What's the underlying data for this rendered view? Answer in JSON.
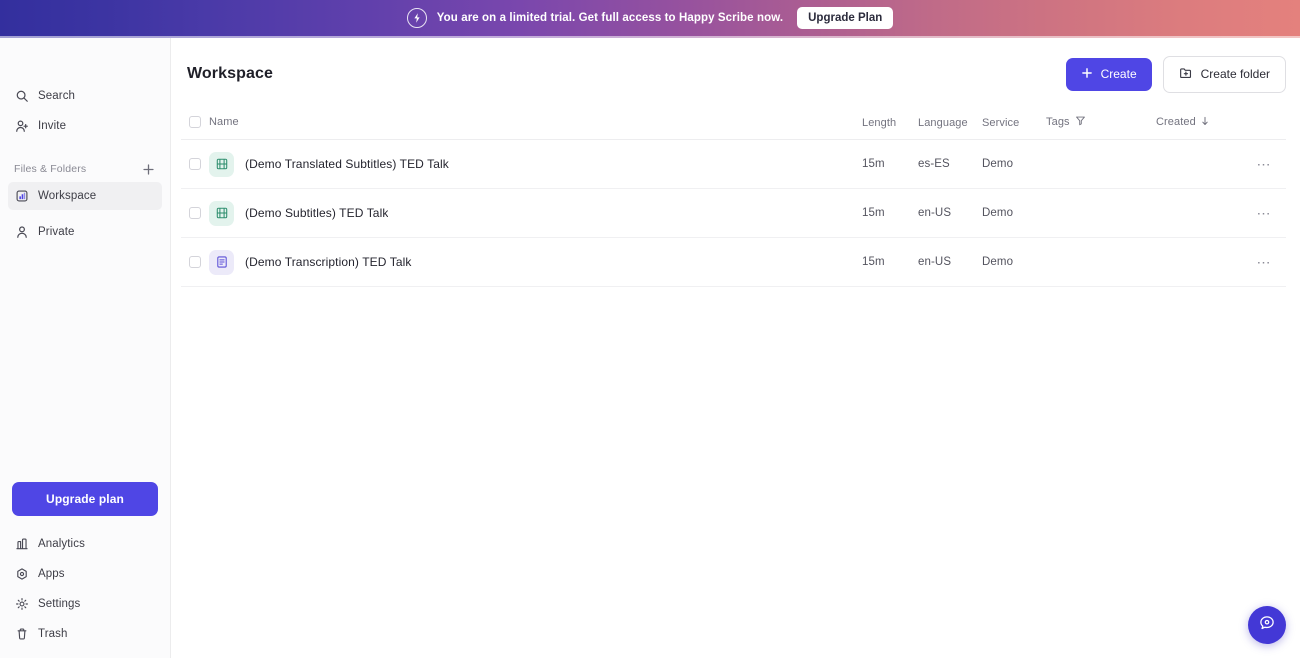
{
  "banner": {
    "logo_icon": "happy-scribe-logo-icon",
    "message": "You are on a limited trial. Get full access to Happy Scribe now.",
    "upgrade_label": "Upgrade Plan"
  },
  "sidebar": {
    "nav": [
      {
        "label": "Search",
        "icon": "search-icon",
        "name": "sidebar-item-search"
      },
      {
        "label": "Invite",
        "icon": "invite-person-icon",
        "name": "sidebar-item-invite"
      }
    ],
    "section": {
      "title": "Files & Folders",
      "add_icon": "plus-icon"
    },
    "folders": [
      {
        "label": "Workspace",
        "icon": "bar-chart-icon",
        "name": "sidebar-item-workspace",
        "active": true
      },
      {
        "label": "Private",
        "icon": "person-icon",
        "name": "sidebar-item-private",
        "active": false
      }
    ],
    "upgrade_label": "Upgrade plan",
    "bottom_nav": [
      {
        "label": "Analytics",
        "icon": "analytics-icon",
        "name": "sidebar-item-analytics"
      },
      {
        "label": "Apps",
        "icon": "apps-icon",
        "name": "sidebar-item-apps"
      },
      {
        "label": "Settings",
        "icon": "gear-icon",
        "name": "sidebar-item-settings"
      },
      {
        "label": "Trash",
        "icon": "trash-icon",
        "name": "sidebar-item-trash"
      }
    ]
  },
  "header": {
    "title": "Workspace",
    "create_label": "Create",
    "create_folder_label": "Create folder"
  },
  "table": {
    "columns": {
      "name": "Name",
      "length": "Length",
      "language": "Language",
      "service": "Service",
      "tags": "Tags",
      "created": "Created"
    },
    "rows": [
      {
        "name": "(Demo Translated Subtitles) TED Talk",
        "length": "15m",
        "language": "es-ES",
        "service": "Demo",
        "tags": "",
        "created": "",
        "icon": "subtitles-film-icon",
        "icon_kind": "subtitles"
      },
      {
        "name": "(Demo Subtitles) TED Talk",
        "length": "15m",
        "language": "en-US",
        "service": "Demo",
        "tags": "",
        "created": "",
        "icon": "subtitles-film-icon",
        "icon_kind": "subtitles"
      },
      {
        "name": "(Demo Transcription) TED Talk",
        "length": "15m",
        "language": "en-US",
        "service": "Demo",
        "tags": "",
        "created": "",
        "icon": "transcription-document-icon",
        "icon_kind": "transcription"
      }
    ],
    "row_menu_label": "⋯"
  },
  "chat": {
    "icon": "chat-help-icon"
  },
  "colors": {
    "accent": "#4f46e5",
    "banner_start": "#332f9e",
    "banner_end": "#e4817d",
    "subtitles_icon_bg": "#e3f3ed",
    "transcription_icon_bg": "#eceaf9",
    "chat_bg": "#4338d6"
  }
}
